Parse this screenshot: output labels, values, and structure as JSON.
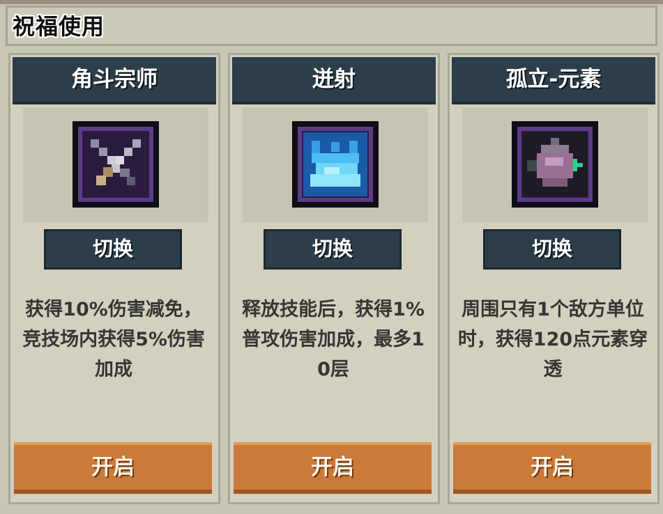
{
  "header": {
    "title": "祝福使用"
  },
  "cards": [
    {
      "title": "角斗宗师",
      "icon": "crossed-swords-icon",
      "switch_label": "切换",
      "description": "获得10%伤害减免，竞技场内获得5%伤害加成",
      "open_label": "开启"
    },
    {
      "title": "迸射",
      "icon": "blue-splash-icon",
      "switch_label": "切换",
      "description": "释放技能后，获得1%普攻伤害加成，最多10层",
      "open_label": "开启"
    },
    {
      "title": "孤立-元素",
      "icon": "isolated-element-icon",
      "switch_label": "切换",
      "description": "周围只有1个敌方单位时，获得120点元素穿透",
      "open_label": "开启"
    }
  ],
  "colors": {
    "title_bar": "#2c3e49",
    "open_button": "#cc7a39",
    "card_bg": "#d3d0c0"
  }
}
